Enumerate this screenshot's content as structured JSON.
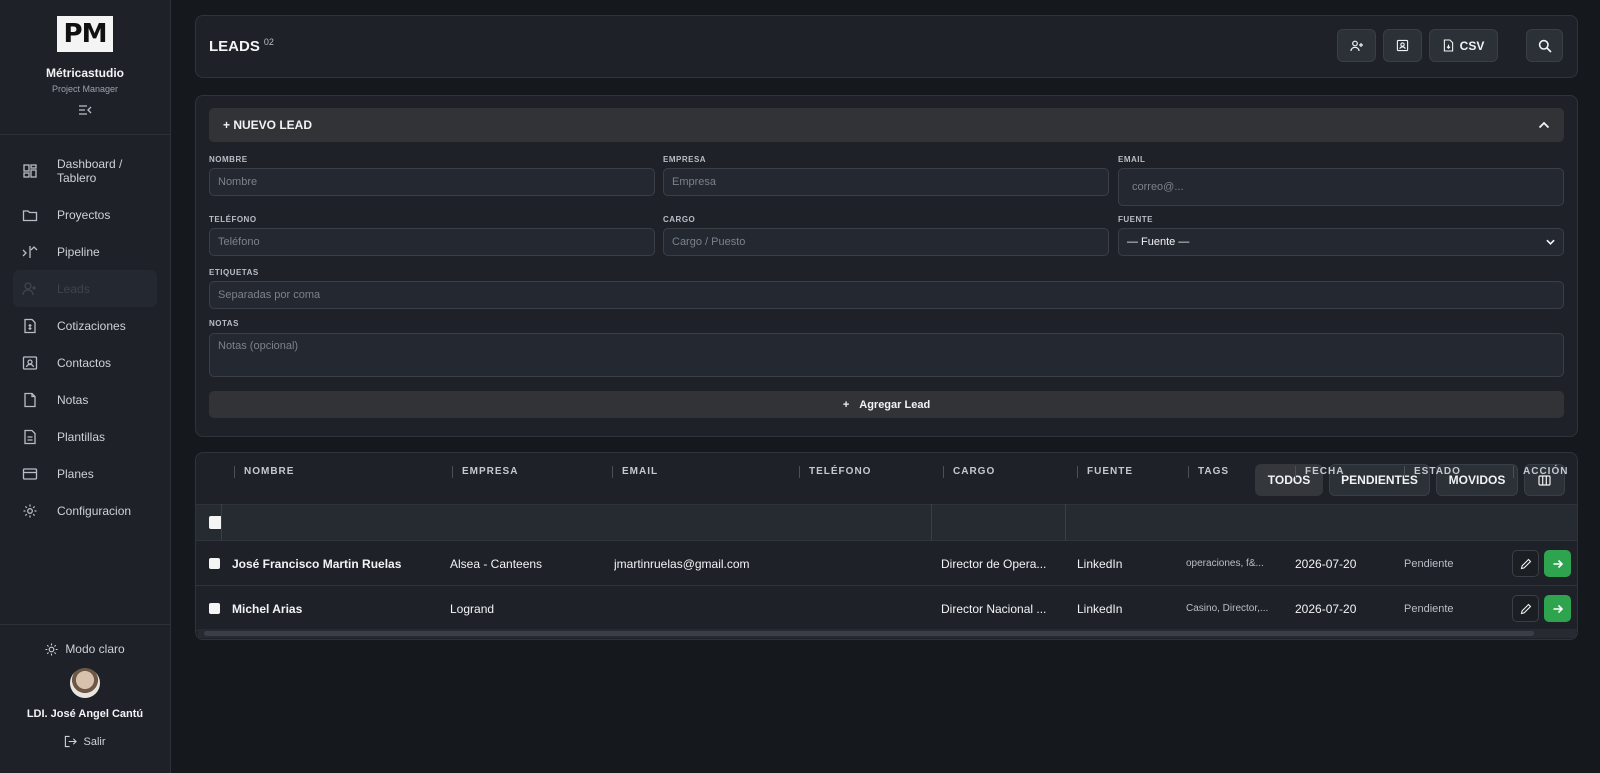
{
  "brand": {
    "logo": "PM",
    "name": "Métricastudio",
    "subtitle": "Project Manager"
  },
  "nav": [
    {
      "label": "Dashboard / Tablero",
      "icon": "dashboard-icon"
    },
    {
      "label": "Proyectos",
      "icon": "folder-icon"
    },
    {
      "label": "Pipeline",
      "icon": "pipeline-icon"
    },
    {
      "label": "Leads",
      "icon": "user-plus-icon",
      "active": true
    },
    {
      "label": "Cotizaciones",
      "icon": "quote-doc-icon"
    },
    {
      "label": "Contactos",
      "icon": "contact-card-icon"
    },
    {
      "label": "Notas",
      "icon": "note-icon"
    },
    {
      "label": "Plantillas",
      "icon": "template-icon"
    },
    {
      "label": "Planes",
      "icon": "card-icon"
    },
    {
      "label": "Configuracion",
      "icon": "gear-icon"
    }
  ],
  "sidebar_bottom": {
    "mode_label": "Modo claro",
    "user_name": "LDI. José Angel Cantú",
    "logout_label": "Salir"
  },
  "header": {
    "title": "LEADS",
    "count": "02",
    "csv_label": "CSV"
  },
  "form": {
    "title": "+ NUEVO LEAD",
    "fields": {
      "nombre": {
        "label": "NOMBRE",
        "placeholder": "Nombre"
      },
      "empresa": {
        "label": "EMPRESA",
        "placeholder": "Empresa"
      },
      "email": {
        "label": "EMAIL",
        "placeholder": "correo@..."
      },
      "telefono": {
        "label": "TELÉFONO",
        "placeholder": "Teléfono"
      },
      "cargo": {
        "label": "CARGO",
        "placeholder": "Cargo / Puesto"
      },
      "fuente": {
        "label": "FUENTE",
        "value": "— Fuente —"
      },
      "etiquetas": {
        "label": "ETIQUETAS",
        "placeholder": "Separadas por coma"
      },
      "notas": {
        "label": "NOTAS",
        "placeholder": "Notas (opcional)"
      }
    },
    "submit_label": "Agregar Lead"
  },
  "filters": [
    "TODOS",
    "PENDIENTES",
    "MOVIDOS"
  ],
  "table": {
    "columns": [
      "NOMBRE",
      "EMPRESA",
      "EMAIL",
      "TELÉFONO",
      "CARGO",
      "FUENTE",
      "TAGS",
      "FECHA",
      "ESTADO",
      "ACCIÓN"
    ],
    "rows": [
      {
        "nombre": "José Francisco Martin Ruelas",
        "empresa": "Alsea - Canteens",
        "email": "jmartinruelas@gmail.com",
        "telefono": "",
        "cargo": "Director de Opera...",
        "fuente": "LinkedIn",
        "tags": "operaciones, f&...",
        "fecha": "2026-07-20",
        "estado": "Pendiente"
      },
      {
        "nombre": "Michel Arias",
        "empresa": "Logrand",
        "email": "",
        "telefono": "",
        "cargo": "Director Nacional ...",
        "fuente": "LinkedIn",
        "tags": "Casino, Director,...",
        "fecha": "2026-07-20",
        "estado": "Pendiente"
      }
    ]
  },
  "colors": {
    "background": "#15181d",
    "panel": "#1e2228",
    "accent_green": "#2ea44f"
  }
}
